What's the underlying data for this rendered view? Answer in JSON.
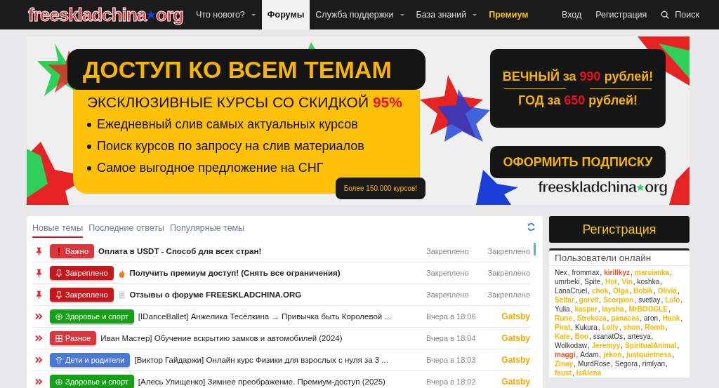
{
  "header": {
    "logo": {
      "left": "freeskladchina",
      "right": "org"
    },
    "nav": [
      {
        "label": "Что нового?",
        "selected": false,
        "dropdown": true
      },
      {
        "label": "Форумы",
        "selected": true,
        "dropdown": false
      },
      {
        "label": "Служба поддержки",
        "selected": false,
        "dropdown": true
      },
      {
        "label": "База знаний",
        "selected": false,
        "dropdown": true
      },
      {
        "label": "Премиум",
        "selected": false,
        "dropdown": false,
        "kind": "premium"
      }
    ],
    "login": "Вход",
    "register": "Регистрация",
    "search": "Поиск"
  },
  "banner": {
    "title": "ДОСТУП КО ВСЕМ ТЕМАМ",
    "subtitle": "ЭКСКЛЮЗИВНЫЕ КУРСЫ СО СКИДКОЙ",
    "discount": "95%",
    "bullets": [
      "Ежедневный слив самых актуальных курсов",
      "Поиск курсов по запросу на слив материалов",
      "Самое выгодное предложение на СНГ"
    ],
    "count_badge": "Более 150.000 курсов!",
    "prices": [
      {
        "before": "ВЕЧНЫЙ за",
        "amount": "990",
        "after": "рублей!"
      },
      {
        "before": "ГОД за",
        "amount": "650",
        "after": "рублей!"
      }
    ],
    "cta": "ОФОРМИТЬ ПОДПИСКУ",
    "logo": {
      "left": "freeskladchina",
      "right": "org"
    }
  },
  "threads": {
    "tabs": [
      {
        "label": "Новые темы",
        "selected": true
      },
      {
        "label": "Последние ответы",
        "selected": false
      },
      {
        "label": "Популярные темы",
        "selected": false
      }
    ],
    "rows": [
      {
        "kind": "pinned",
        "prefix": {
          "kind": "exclaim",
          "label": "Важно",
          "color": "#d9363e"
        },
        "title": "Оплата в USDT - Способ для всех стран!",
        "date": "Закреплено",
        "author": "Закреплено"
      },
      {
        "kind": "pinned",
        "prefix": {
          "kind": "pin",
          "label": "Закреплено",
          "color": "#c8161d"
        },
        "icon": {
          "kind": "fire"
        },
        "title": "Получить премиум доступ! (Снять все ограничения)",
        "date": "Закреплено",
        "author": "Закреплено"
      },
      {
        "kind": "pinned",
        "prefix": {
          "kind": "pin",
          "label": "Закреплено",
          "color": "#c8161d"
        },
        "icon": {
          "kind": "doc"
        },
        "title": "Отзывы о форуме FREESKLADCHINA.ORG",
        "date": "Закреплено",
        "author": "Закреплено"
      },
      {
        "kind": "new",
        "prefix": {
          "kind": "plus",
          "label": "Здоровье и спорт",
          "color": "#16a016"
        },
        "title": "[IDanceBallet] Анжелика Тесёлкина → Привычка быть Королевой ...",
        "date": "Вчера в 18:06",
        "author": "Gatsby"
      },
      {
        "kind": "new",
        "prefix": {
          "kind": "grid",
          "label": "Разное",
          "color": "#d9363e"
        },
        "title": "Иван Мастер] Обучение вскрытию замков и автомобилей (2024)",
        "date": "Вчера в 18:04",
        "author": "Gatsby"
      },
      {
        "kind": "new",
        "prefix": {
          "kind": "shirt",
          "label": "Дети и родители",
          "color": "#4a78d8"
        },
        "title": "[Виктор Гайдаржи] Онлайн курс Физики для взрослых с нуля за 3 ...",
        "date": "Вчера в 18:03",
        "author": "Gatsby"
      },
      {
        "kind": "new",
        "prefix": {
          "kind": "plus",
          "label": "Здоровье и спорт",
          "color": "#16a016"
        },
        "title": "[Алесь Улищенко] Зимнее преображение. Премиум-доступ (2025)",
        "date": "Вчера в 18:02",
        "author": "Gatsby"
      }
    ]
  },
  "sidebar": {
    "register": "Регистрация",
    "online_title": "Пользователи онлайн",
    "separator": ",",
    "users": [
      {
        "name": "Nex"
      },
      {
        "name": "frommax"
      },
      {
        "name": "kirillkyz",
        "color": "#f0501e"
      },
      {
        "name": "marsianka",
        "color": "#f5b800"
      },
      {
        "name": "umrbeki"
      },
      {
        "name": "Spite"
      },
      {
        "name": "Hot",
        "color": "#f5b800"
      },
      {
        "name": "Vin",
        "color": "#f5b800"
      },
      {
        "name": "koshka"
      },
      {
        "name": "LanaCruel"
      },
      {
        "name": "chok",
        "color": "#f5b800"
      },
      {
        "name": "Olga",
        "color": "#f5b800"
      },
      {
        "name": "Bobik",
        "color": "#f5b800"
      },
      {
        "name": "Olivia",
        "color": "#f5b800"
      },
      {
        "name": "Selfar",
        "color": "#f5b800"
      },
      {
        "name": "gorvit",
        "color": "#f5b800"
      },
      {
        "name": "Scorpion",
        "color": "#f5b800"
      },
      {
        "name": "svetlay"
      },
      {
        "name": "Lolo",
        "color": "#f5b800"
      },
      {
        "name": "Yulia"
      },
      {
        "name": "kasper",
        "color": "#f5b800"
      },
      {
        "name": "laysha",
        "color": "#f5b800"
      },
      {
        "name": "MrBOOGLE",
        "color": "#f5b800"
      },
      {
        "name": "Rune",
        "color": "#f5b800"
      },
      {
        "name": "Strekoza",
        "color": "#f5b800"
      },
      {
        "name": "panacea",
        "color": "#f5b800"
      },
      {
        "name": "aron"
      },
      {
        "name": "Hank",
        "color": "#f5b800"
      },
      {
        "name": "Pirat",
        "color": "#f5b800"
      },
      {
        "name": "Kukura"
      },
      {
        "name": "Lolly",
        "color": "#f5b800"
      },
      {
        "name": "shon",
        "color": "#f5b800"
      },
      {
        "name": "Romb",
        "color": "#f5b800"
      },
      {
        "name": "Kate",
        "color": "#f5b800"
      },
      {
        "name": "Boo",
        "color": "#f5b800"
      },
      {
        "name": "ssanatOs"
      },
      {
        "name": "artesya"
      },
      {
        "name": "Wolkodaw"
      },
      {
        "name": "Jeremyy",
        "color": "#f5b800"
      },
      {
        "name": "SpiritualAnimal",
        "color": "#f5b800"
      },
      {
        "name": "maggi",
        "color": "#f0501e"
      },
      {
        "name": "Adam"
      },
      {
        "name": "jekon",
        "color": "#f5b800"
      },
      {
        "name": "justquietness",
        "color": "#f5b800"
      },
      {
        "name": "Zinay",
        "color": "#f5b800"
      },
      {
        "name": "MurdRose"
      },
      {
        "name": "Segora"
      },
      {
        "name": "rimlyan"
      },
      {
        "name": "faust",
        "color": "#f5b800"
      },
      {
        "name": "IsAlena",
        "color": "#f5b800"
      }
    ]
  }
}
